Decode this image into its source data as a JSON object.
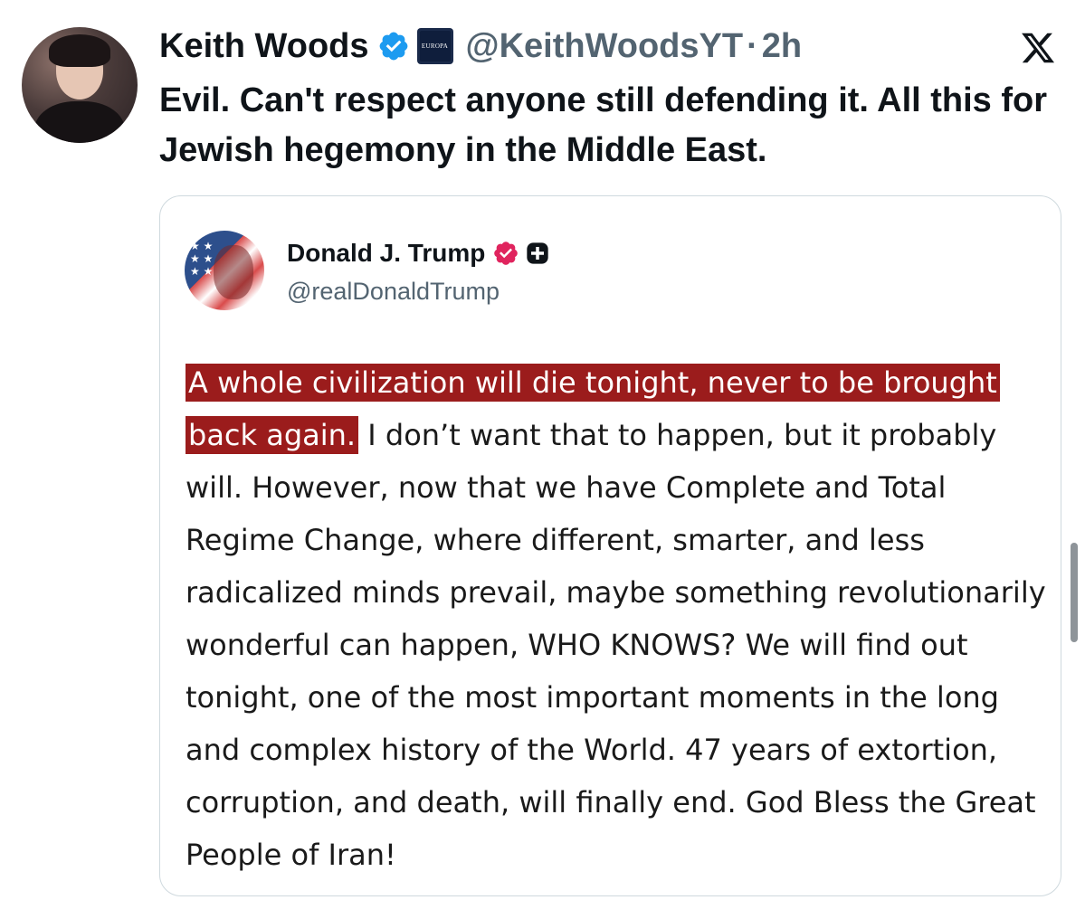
{
  "tweet": {
    "author_name": "Keith Woods",
    "badge_text": "EUROPA",
    "handle": "@KeithWoodsYT",
    "separator": "·",
    "time": "2h",
    "text": "Evil. Can't respect anyone still defending it. All this for Jewish hegemony in the Middle East.",
    "avatar_icon": "profile-photo",
    "verified_color": "#1d9bf0"
  },
  "quoted": {
    "author_name": "Donald J. Trump",
    "handle": "@realDonaldTrump",
    "verified_color": "#e0245e",
    "highlighted_text": "A whole civilization will die tonight, never to be brought back again.",
    "body_text": " I don’t want that to happen, but it probably will. However, now that we have Complete and Total Regime Change, where different, smarter, and less radicalized minds prevail, maybe something revolutionarily wonderful can happen, WHO KNOWS? We will find out tonight, one of the most important moments in the long and complex history of the World. 47 years of extortion, corruption, and death, will finally end. God Bless the Great People of Iran!",
    "highlight_color": "#9b1c1c"
  },
  "icons": {
    "platform_logo": "x-logo",
    "plus_badge": "plus-badge-icon"
  }
}
